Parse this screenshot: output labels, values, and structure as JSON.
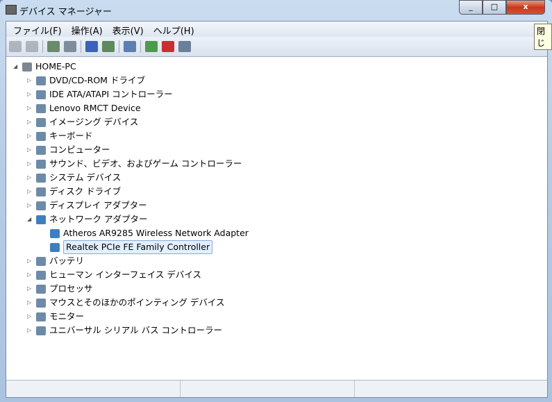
{
  "window": {
    "title": "デバイス マネージャー",
    "tooltip": "閉じ",
    "close": "x",
    "min": "_",
    "max": "□"
  },
  "menu": [
    "ファイル(F)",
    "操作(A)",
    "表示(V)",
    "ヘルプ(H)"
  ],
  "toolbar": [
    "back-icon",
    "forward-icon",
    "show-hide-console-tree-icon",
    "properties-icon",
    "help-icon",
    "action-pane-icon",
    "scan-hardware-icon",
    "update-driver-icon",
    "uninstall-icon",
    "disable-icon"
  ],
  "tree": {
    "root": "HOME-PC",
    "items": [
      {
        "label": "DVD/CD-ROM ドライブ",
        "icon": "dvd-icon"
      },
      {
        "label": "IDE ATA/ATAPI コントローラー",
        "icon": "ide-icon"
      },
      {
        "label": "Lenovo RMCT Device",
        "icon": "device-icon"
      },
      {
        "label": "イメージング デバイス",
        "icon": "camera-icon"
      },
      {
        "label": "キーボード",
        "icon": "keyboard-icon"
      },
      {
        "label": "コンピューター",
        "icon": "computer-icon"
      },
      {
        "label": "サウンド、ビデオ、およびゲーム コントローラー",
        "icon": "speaker-icon"
      },
      {
        "label": "システム デバイス",
        "icon": "system-icon"
      },
      {
        "label": "ディスク ドライブ",
        "icon": "disk-icon"
      },
      {
        "label": "ディスプレイ アダプター",
        "icon": "display-icon"
      },
      {
        "label": "ネットワーク アダプター",
        "icon": "network-icon",
        "expanded": true,
        "children": [
          "Atheros AR9285 Wireless Network Adapter",
          "Realtek PCIe FE Family Controller"
        ]
      },
      {
        "label": "バッテリ",
        "icon": "battery-icon"
      },
      {
        "label": "ヒューマン インターフェイス デバイス",
        "icon": "hid-icon"
      },
      {
        "label": "プロセッサ",
        "icon": "processor-icon"
      },
      {
        "label": "マウスとそのほかのポインティング デバイス",
        "icon": "mouse-icon"
      },
      {
        "label": "モニター",
        "icon": "monitor-icon"
      },
      {
        "label": "ユニバーサル シリアル バス コントローラー",
        "icon": "usb-icon"
      }
    ],
    "selected": "Realtek PCIe FE Family Controller"
  }
}
